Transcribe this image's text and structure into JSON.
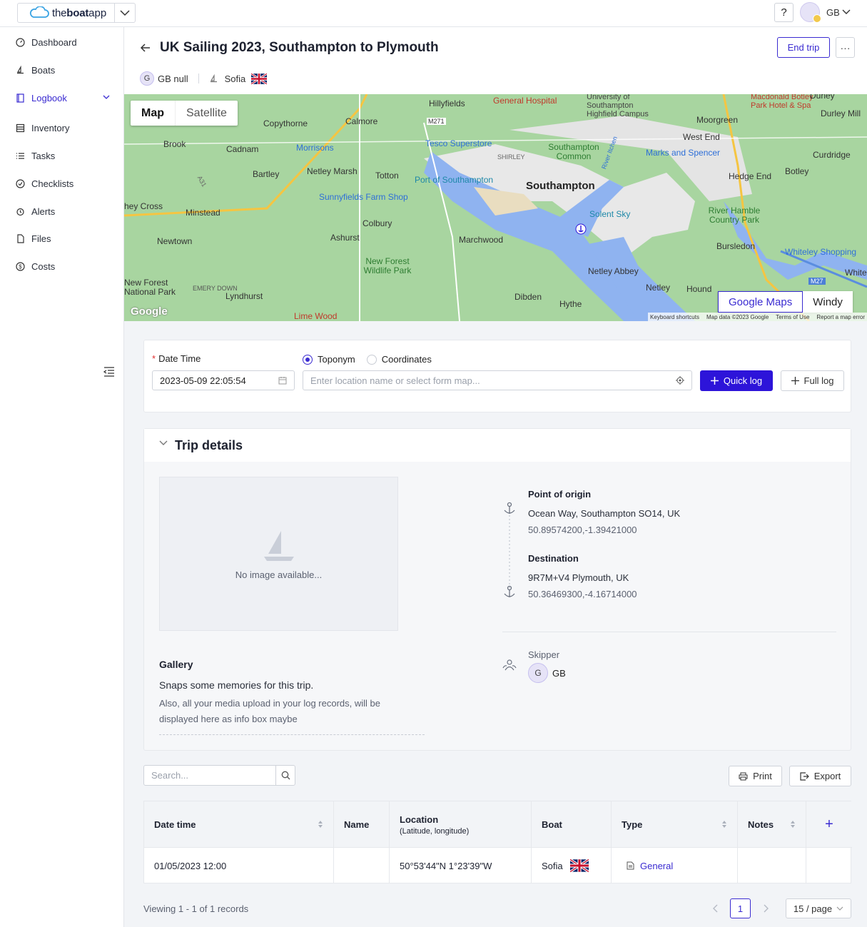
{
  "app": {
    "logo_light": "the",
    "logo_bold": "boat",
    "logo_tail": "app"
  },
  "top": {
    "help": "?",
    "user_initials": "GB"
  },
  "sidebar": {
    "items": [
      {
        "label": "Dashboard",
        "icon": "dashboard-icon"
      },
      {
        "label": "Boats",
        "icon": "boat-icon"
      },
      {
        "label": "Logbook",
        "icon": "logbook-icon",
        "active": true
      },
      {
        "label": "Inventory",
        "icon": "inventory-icon"
      },
      {
        "label": "Tasks",
        "icon": "tasks-icon"
      },
      {
        "label": "Checklists",
        "icon": "checklists-icon"
      },
      {
        "label": "Alerts",
        "icon": "alerts-icon"
      },
      {
        "label": "Files",
        "icon": "files-icon"
      },
      {
        "label": "Costs",
        "icon": "costs-icon"
      }
    ]
  },
  "header": {
    "title": "UK Sailing 2023, Southampton to Plymouth",
    "end_trip": "End trip",
    "more": "···",
    "avatar_letter": "G",
    "owner": "GB null",
    "boat": "Sofia"
  },
  "map": {
    "tab_map": "Map",
    "tab_satellite": "Satellite",
    "google_maps": "Google Maps",
    "windy": "Windy",
    "google_logo": "Google",
    "footer": [
      "Keyboard shortcuts",
      "Map data ©2023 Google",
      "Terms of Use",
      "Report a map error"
    ],
    "labels": [
      "Hillyfields",
      "General Hospital",
      "University of Southampton Highfield Campus",
      "Macdonald Botley Park Hotel & Spa",
      "Durley",
      "Durley Mill",
      "Copythorne",
      "Calmore",
      "M271",
      "Moorgreen",
      "Brook",
      "Cadnam",
      "Morrisons",
      "Tesco Superstore",
      "SHIRLEY",
      "Southampton Common",
      "River Itchen",
      "West End",
      "Marks and Spencer",
      "Curdridge",
      "Bartley",
      "Netley Marsh",
      "Totton",
      "Port of Southampton",
      "Southampton",
      "Hedge End",
      "Botley",
      "A31",
      "Sunnyfields Farm Shop",
      "Solent Sky",
      "hey Cross",
      "Minstead",
      "Colbury",
      "River Hamble Country Park",
      "Ashurst",
      "Marchwood",
      "Bursledon",
      "Newtown",
      "New Forest Wildlife Park",
      "Whiteley Shopping",
      "Netley Abbey",
      "White",
      "New Forest National Park",
      "EMERY DOWN",
      "Lyndhurst",
      "Netley",
      "Hound",
      "M27",
      "Dibden",
      "Hythe",
      "Lime Wood"
    ]
  },
  "log_form": {
    "date_label": "Date Time",
    "date_value": "2023-05-09 22:05:54",
    "radio_toponym": "Toponym",
    "radio_coordinates": "Coordinates",
    "location_placeholder": "Enter location name or select form map...",
    "quick_log": "Quick log",
    "full_log": "Full log"
  },
  "trip": {
    "title": "Trip details",
    "no_image": "No image available...",
    "gallery_title": "Gallery",
    "gallery_sub": "Snaps some memories for this trip.",
    "gallery_note": "Also, all your media upload in your log records, will be displayed here as info box maybe",
    "origin_title": "Point of origin",
    "origin_addr": "Ocean Way, Southampton SO14, UK",
    "origin_coord": "50.89574200,-1.39421000",
    "dest_title": "Destination",
    "dest_addr": "9R7M+V4 Plymouth, UK",
    "dest_coord": "50.36469300,-4.16714000",
    "skipper_label": "Skipper",
    "skipper_letter": "G",
    "skipper_name": "GB"
  },
  "records": {
    "search_placeholder": "Search...",
    "print": "Print",
    "export": "Export",
    "columns": {
      "datetime": "Date time",
      "name": "Name",
      "location": "Location",
      "location_sub": "(Latitude, longitude)",
      "boat": "Boat",
      "type": "Type",
      "notes": "Notes",
      "add": "+"
    },
    "rows": [
      {
        "datetime": "01/05/2023 12:00",
        "name": "",
        "location": "50°53'44\"N 1°23'39\"W",
        "boat": "Sofia",
        "type": "General",
        "notes": ""
      }
    ],
    "footer": "Viewing 1 - 1 of 1 records",
    "page": "1",
    "page_size": "15 / page"
  },
  "colors": {
    "accent": "#2d14d9",
    "map_land": "#a8d5a0",
    "map_water": "#8fb3f0"
  }
}
